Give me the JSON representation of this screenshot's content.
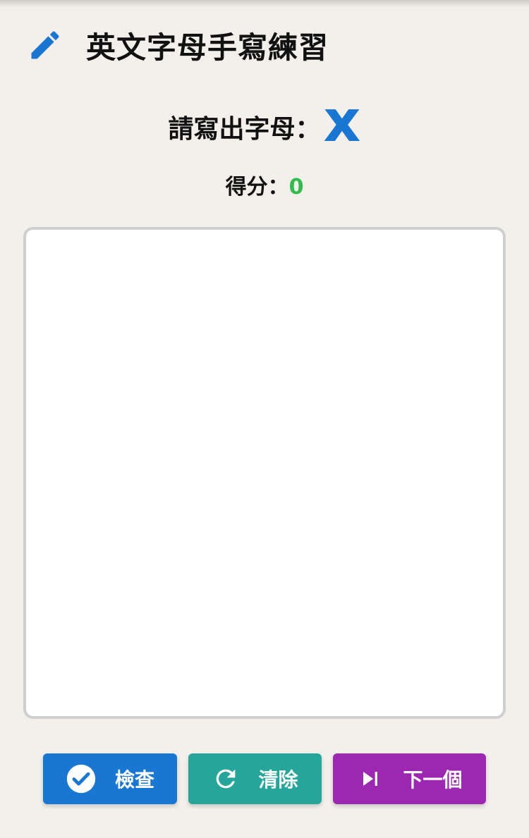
{
  "header": {
    "icon": "pencil-icon",
    "title": "英文字母手寫練習"
  },
  "prompt": {
    "label": "請寫出字母：",
    "letter": "x"
  },
  "score": {
    "label": "得分：",
    "value": "0"
  },
  "buttons": {
    "check": {
      "label": "檢查",
      "icon": "check-circle-icon"
    },
    "clear": {
      "label": "清除",
      "icon": "refresh-icon"
    },
    "next": {
      "label": "下一個",
      "icon": "skip-next-icon"
    }
  },
  "colors": {
    "background": "#f3f0eb",
    "accent": "#1976d2",
    "score": "#2ebd4a",
    "check": "#1976d2",
    "clear": "#26a69a",
    "next": "#9c27b0"
  }
}
